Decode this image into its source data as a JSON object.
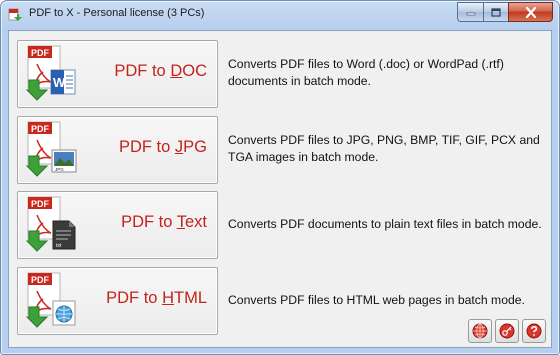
{
  "window": {
    "title": "PDF to X - Personal license (3 PCs)",
    "icons": {
      "app": "pdf-to-x-app-icon",
      "minimize": "minimize-icon",
      "maximize": "maximize-icon",
      "close": "close-icon"
    }
  },
  "converters": [
    {
      "prefix": "PDF to ",
      "hotkey": "D",
      "suffix": "OC",
      "icon": "pdf-to-doc-icon",
      "description": "Converts PDF files to Word (.doc) or WordPad (.rtf) documents in batch mode."
    },
    {
      "prefix": "PDF to ",
      "hotkey": "J",
      "suffix": "PG",
      "icon": "pdf-to-jpg-icon",
      "description": "Converts PDF files to JPG, PNG, BMP, TIF, GIF, PCX and TGA images in batch mode."
    },
    {
      "prefix": "PDF to ",
      "hotkey": "T",
      "suffix": "ext",
      "icon": "pdf-to-text-icon",
      "description": "Converts PDF documents to plain text files in batch mode."
    },
    {
      "prefix": "PDF to ",
      "hotkey": "H",
      "suffix": "TML",
      "icon": "pdf-to-html-icon",
      "description": "Converts PDF files to HTML web pages in batch mode."
    }
  ],
  "footer_buttons": [
    {
      "icon": "globe-icon"
    },
    {
      "icon": "key-icon"
    },
    {
      "icon": "help-icon"
    }
  ],
  "colors": {
    "label": "#c2241c",
    "pdf_red": "#c8281e",
    "arrow_green": "#3da13a"
  }
}
